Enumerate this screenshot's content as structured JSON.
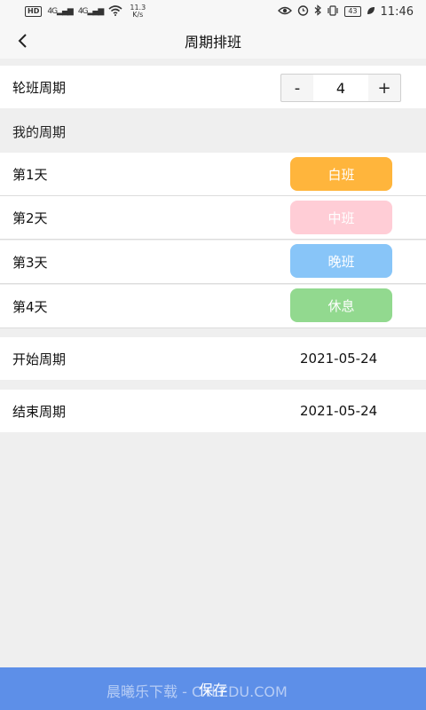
{
  "status_bar": {
    "hd": "HD",
    "signal1": "4G",
    "signal2": "4G",
    "speed_value": "11.3",
    "speed_unit": "K/s",
    "battery": "43",
    "time": "11:46"
  },
  "nav": {
    "title": "周期排班"
  },
  "period": {
    "label": "轮班周期",
    "minus": "-",
    "value": "4",
    "plus": "+"
  },
  "my_cycle_label": "我的周期",
  "days": [
    {
      "label": "第1天",
      "shift": "白班",
      "color": "#ffb53c"
    },
    {
      "label": "第2天",
      "shift": "中班",
      "color": "#ffcdd6"
    },
    {
      "label": "第3天",
      "shift": "晚班",
      "color": "#88c5f8"
    },
    {
      "label": "第4天",
      "shift": "休息",
      "color": "#92d98f"
    }
  ],
  "start": {
    "label": "开始周期",
    "value": "2021-05-24"
  },
  "end": {
    "label": "结束周期",
    "value": "2021-05-24"
  },
  "save_label": "保存",
  "watermark": "晨曦乐下载 - CXLEDU.COM"
}
